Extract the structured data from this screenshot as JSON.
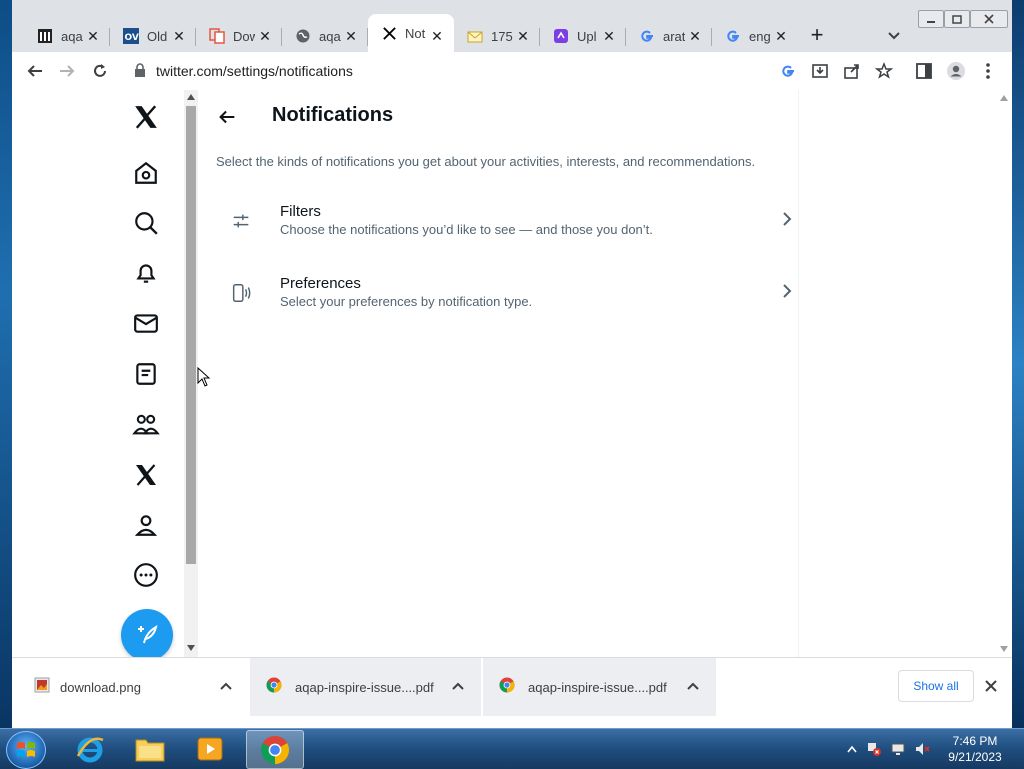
{
  "browser": {
    "tabs": [
      {
        "label": "aqa",
        "icon": "museum-icon",
        "active": false
      },
      {
        "label": "Old",
        "icon": "ov-icon",
        "active": false
      },
      {
        "label": "Dow",
        "icon": "pdf-convert-icon",
        "active": false
      },
      {
        "label": "aqa",
        "icon": "globe-icon",
        "active": false
      },
      {
        "label": "Not",
        "icon": "x-logo-icon",
        "active": true
      },
      {
        "label": "175",
        "icon": "mail-icon",
        "active": false
      },
      {
        "label": "Upl",
        "icon": "upload-app-icon",
        "active": false
      },
      {
        "label": "arat",
        "icon": "google-icon",
        "active": false
      },
      {
        "label": "eng",
        "icon": "google-icon",
        "active": false
      }
    ],
    "url": "twitter.com/settings/notifications"
  },
  "page": {
    "title": "Notifications",
    "description": "Select the kinds of notifications you get about your activities, interests, and recommendations.",
    "settings": [
      {
        "title": "Filters",
        "subtitle": "Choose the notifications you’d like to see — and those you don’t.",
        "icon": "sliders-icon"
      },
      {
        "title": "Preferences",
        "subtitle": "Select your preferences by notification type.",
        "icon": "device-notification-icon"
      }
    ]
  },
  "downloads": {
    "items": [
      {
        "name": "download.png",
        "icon": "image-file-icon"
      },
      {
        "name": "aqap-inspire-issue....pdf",
        "icon": "chrome-icon"
      },
      {
        "name": "aqap-inspire-issue....pdf",
        "icon": "chrome-icon"
      }
    ],
    "show_all_label": "Show all"
  },
  "taskbar": {
    "time": "7:46 PM",
    "date": "9/21/2023"
  },
  "colors": {
    "accent": "#1d9bf0",
    "text_primary": "#0f1419",
    "text_secondary": "#536471"
  }
}
